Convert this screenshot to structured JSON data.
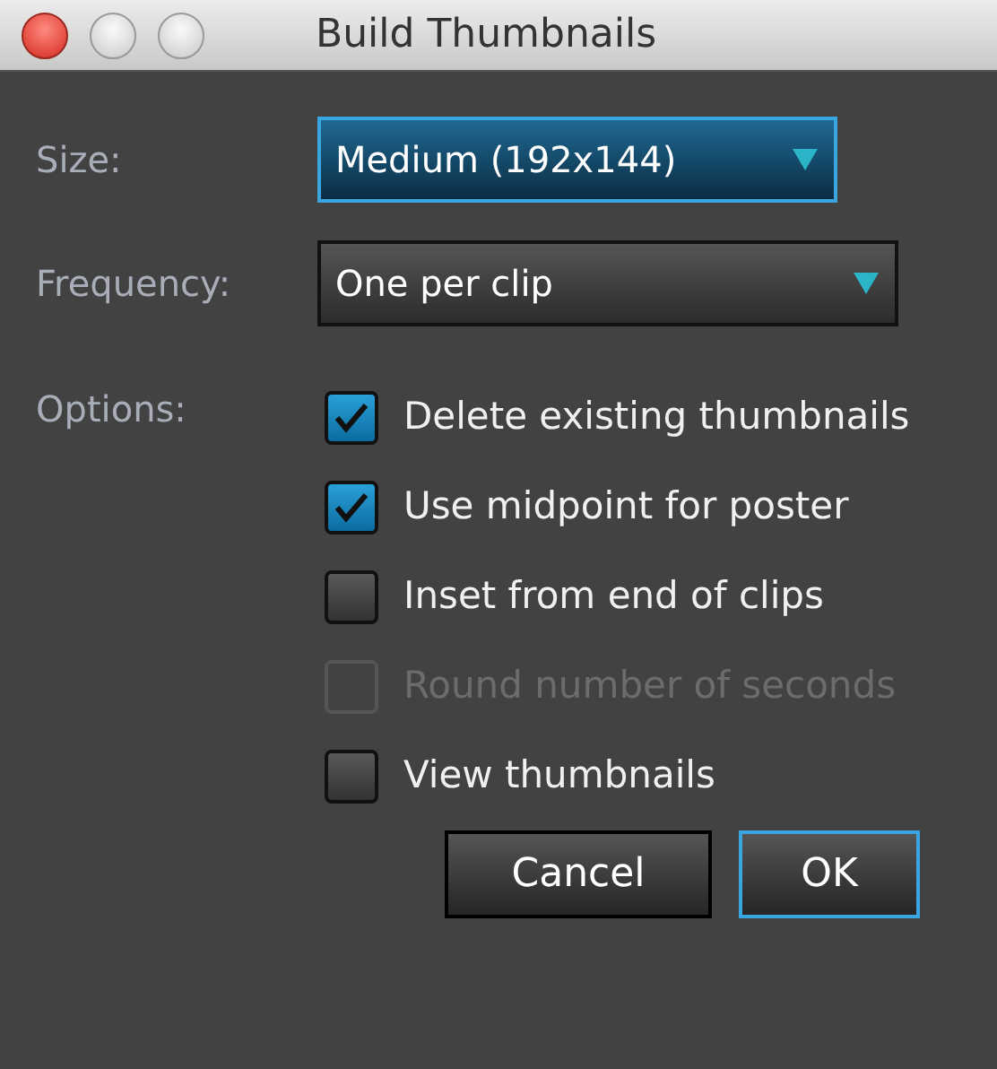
{
  "window": {
    "title": "Build Thumbnails"
  },
  "fields": [
    {
      "label": "Size:",
      "value": "Medium (192x144)",
      "focused": true
    },
    {
      "label": "Frequency:",
      "value": "One per clip",
      "focused": false
    }
  ],
  "options": {
    "label": "Options:",
    "items": [
      {
        "label": "Delete existing thumbnails",
        "checked": true,
        "disabled": false
      },
      {
        "label": "Use midpoint for poster",
        "checked": true,
        "disabled": false
      },
      {
        "label": "Inset from end of clips",
        "checked": false,
        "disabled": false
      },
      {
        "label": "Round number of seconds",
        "checked": false,
        "disabled": true
      },
      {
        "label": "View thumbnails",
        "checked": false,
        "disabled": false
      }
    ]
  },
  "buttons": [
    {
      "label": "Cancel",
      "focused": false
    },
    {
      "label": "OK",
      "focused": true
    }
  ]
}
